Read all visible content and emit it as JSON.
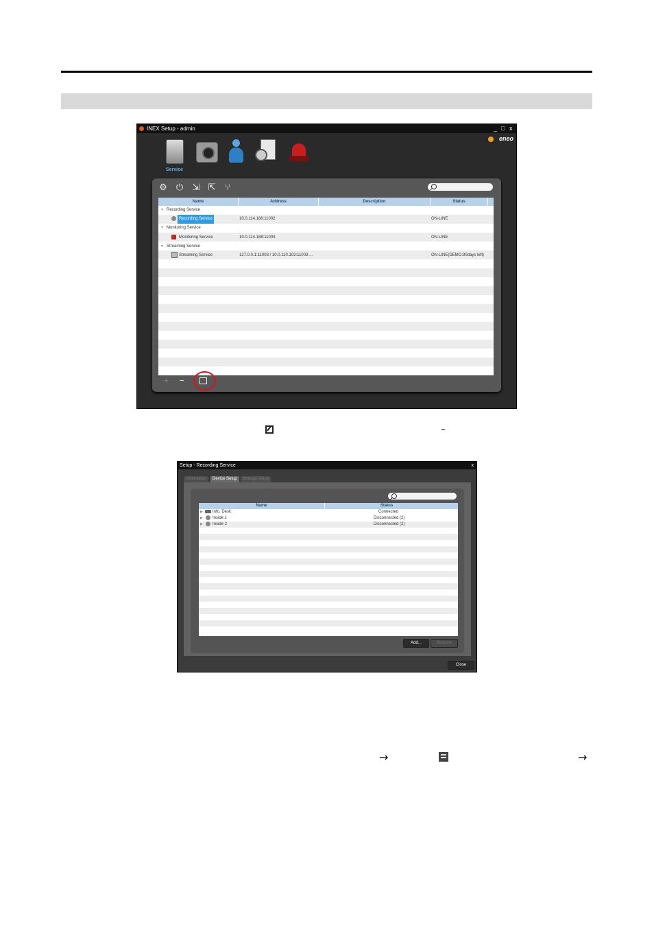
{
  "window1": {
    "title": "INEX Setup - admin",
    "controls": {
      "minimize": "_",
      "maximize": "□",
      "close": "x"
    },
    "brand": "eneo",
    "top_tabs": [
      {
        "icon": "server-icon",
        "label": "Service"
      },
      {
        "icon": "camera-icon",
        "label": ""
      },
      {
        "icon": "user-icon",
        "label": ""
      },
      {
        "icon": "schedule-clock-icon",
        "label": ""
      },
      {
        "icon": "alarm-light-icon",
        "label": ""
      }
    ],
    "toolbar_icons": [
      "gear-icon",
      "upload-icon",
      "import-icon",
      "export-icon",
      "network-icon"
    ],
    "columns": [
      "Name",
      "Address",
      "Description",
      "Status"
    ],
    "groups": [
      {
        "label": "Recording Service",
        "item": {
          "name": "Recording Service",
          "address": "10.0.114.188:11002",
          "description": "",
          "status": "ON-LINE",
          "selected": true
        }
      },
      {
        "label": "Monitoring Service",
        "item": {
          "name": "Monitoring Service",
          "address": "10.0.114.188:11004",
          "description": "",
          "status": "ON-LINE",
          "selected": false
        }
      },
      {
        "label": "Streaming Service",
        "item": {
          "name": "Streaming Service",
          "address": "127.0.0.1:11003  /  10.0.110.103:11003  ...",
          "description": "",
          "status": "ON-LINE(DEMO:90days left)",
          "selected": false
        }
      }
    ],
    "bottom_buttons": {
      "add": "+",
      "remove": "−"
    }
  },
  "inline_glyphs": {
    "dash": "–",
    "arrow1": "→",
    "arrow2": "→"
  },
  "window2": {
    "title": "Setup - Recording Service",
    "close": "x",
    "tabs": [
      "Information",
      "Device Setup",
      "Storage Setup"
    ],
    "active_tab": "Device Setup",
    "columns": [
      "Name",
      "Status"
    ],
    "rows": [
      {
        "name": "Info. Desk",
        "status": "Connected"
      },
      {
        "name": "Inside 1",
        "status": "Disconnected (2)"
      },
      {
        "name": "Inside 2",
        "status": "Disconnected (2)"
      }
    ],
    "buttons": {
      "add": "Add...",
      "remove": "Remove",
      "close": "Close"
    }
  }
}
